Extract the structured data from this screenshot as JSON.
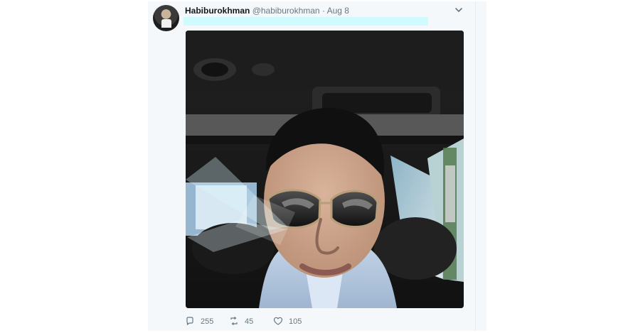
{
  "tweet": {
    "display_name": "Habiburokhman",
    "handle": "@habiburokhman",
    "separator": "·",
    "date": "Aug 8",
    "reply_count": "255",
    "retweet_count": "45",
    "like_count": "105"
  },
  "icons": {
    "caret": "chevron-down-icon",
    "reply": "reply-icon",
    "retweet": "retweet-icon",
    "like": "heart-icon"
  },
  "colors": {
    "highlight": "#cffafe",
    "panel": "#f5f8fa",
    "muted": "#657786",
    "text": "#14171a"
  }
}
